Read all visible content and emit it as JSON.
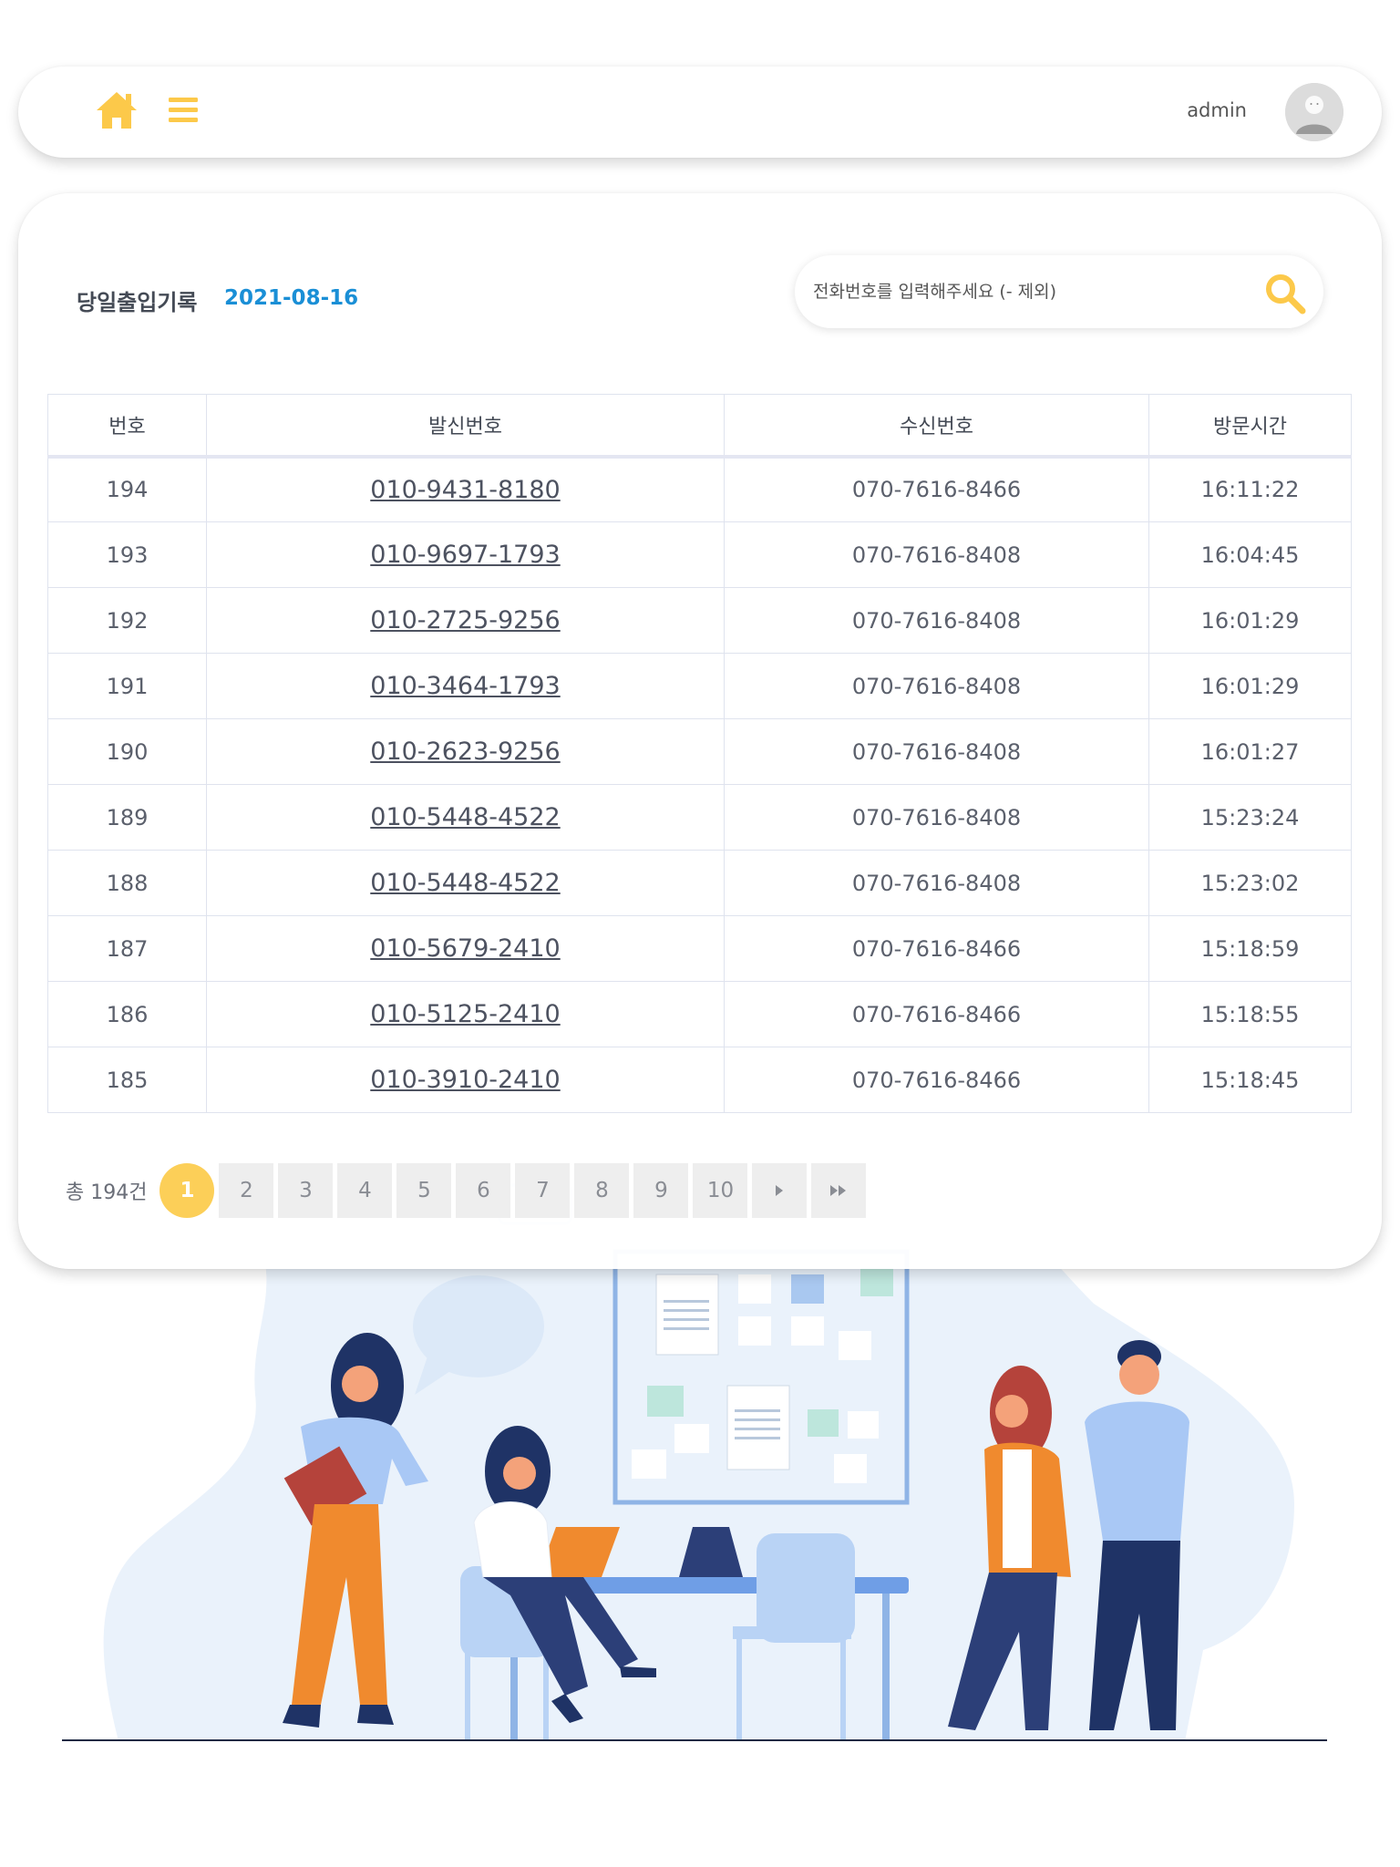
{
  "header": {
    "home_icon": "home-icon",
    "menu_icon": "hamburger-menu-icon",
    "user_label": "admin",
    "avatar_icon": "user-avatar-icon",
    "accent_color": "#fcc94a"
  },
  "page": {
    "title": "당일출입기록",
    "date": "2021-08-16",
    "date_color": "#1a8fd6"
  },
  "search": {
    "placeholder": "전화번호를 입력해주세요 (- 제외)",
    "icon": "search-icon"
  },
  "table": {
    "headers": [
      "번호",
      "발신번호",
      "수신번호",
      "방문시간"
    ],
    "rows": [
      {
        "no": "194",
        "caller": "010-9431-8180",
        "receiver": "070-7616-8466",
        "time": "16:11:22"
      },
      {
        "no": "193",
        "caller": "010-9697-1793",
        "receiver": "070-7616-8408",
        "time": "16:04:45"
      },
      {
        "no": "192",
        "caller": "010-2725-9256",
        "receiver": "070-7616-8408",
        "time": "16:01:29"
      },
      {
        "no": "191",
        "caller": "010-3464-1793",
        "receiver": "070-7616-8408",
        "time": "16:01:29"
      },
      {
        "no": "190",
        "caller": "010-2623-9256",
        "receiver": "070-7616-8408",
        "time": "16:01:27"
      },
      {
        "no": "189",
        "caller": "010-5448-4522",
        "receiver": "070-7616-8408",
        "time": "15:23:24"
      },
      {
        "no": "188",
        "caller": "010-5448-4522",
        "receiver": "070-7616-8408",
        "time": "15:23:02"
      },
      {
        "no": "187",
        "caller": "010-5679-2410",
        "receiver": "070-7616-8466",
        "time": "15:18:59"
      },
      {
        "no": "186",
        "caller": "010-5125-2410",
        "receiver": "070-7616-8466",
        "time": "15:18:55"
      },
      {
        "no": "185",
        "caller": "010-3910-2410",
        "receiver": "070-7616-8466",
        "time": "15:18:45"
      }
    ]
  },
  "pagination": {
    "total": "총 194건",
    "pages": [
      "1",
      "2",
      "3",
      "4",
      "5",
      "6",
      "7",
      "8",
      "9",
      "10"
    ],
    "current": "1",
    "next_icon": "next-page-icon",
    "last_icon": "last-page-icon"
  }
}
